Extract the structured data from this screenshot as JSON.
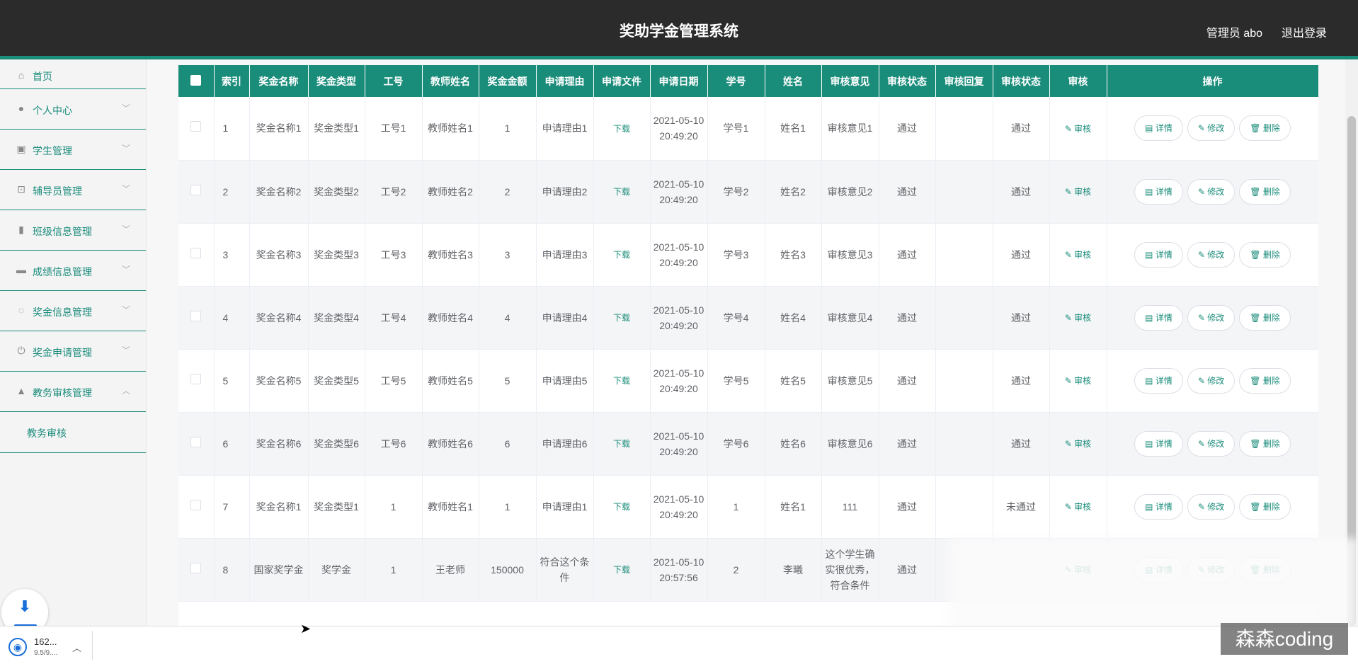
{
  "header": {
    "title": "奖助学金管理系统",
    "user": "管理员 abo",
    "logout": "退出登录"
  },
  "sidebar": {
    "items": [
      {
        "label": "首页",
        "icon": "home-icon",
        "glyph": "⌂",
        "has_children": false
      },
      {
        "label": "个人中心",
        "icon": "user-icon",
        "glyph": "●",
        "has_children": true,
        "chev": "﹀"
      },
      {
        "label": "学生管理",
        "icon": "clipboard-icon",
        "glyph": "▣",
        "has_children": true,
        "chev": "﹀"
      },
      {
        "label": "辅导员管理",
        "icon": "crop-icon",
        "glyph": "⊡",
        "has_children": true,
        "chev": "﹀"
      },
      {
        "label": "班级信息管理",
        "icon": "bar-chart-icon",
        "glyph": "▮",
        "has_children": true,
        "chev": "﹀"
      },
      {
        "label": "成绩信息管理",
        "icon": "monitor-icon",
        "glyph": "▬",
        "has_children": true,
        "chev": "﹀"
      },
      {
        "label": "奖金信息管理",
        "icon": "microphone-icon",
        "glyph": "◌",
        "has_children": true,
        "chev": "﹀"
      },
      {
        "label": "奖金申请管理",
        "icon": "power-icon",
        "glyph": "⏻",
        "has_children": true,
        "chev": "﹀"
      },
      {
        "label": "教务审核管理",
        "icon": "trend-icon",
        "glyph": "▲",
        "has_children": true,
        "chev": "︿"
      }
    ],
    "sub_item": "教务审核"
  },
  "table": {
    "headers": [
      "",
      "索引",
      "奖金名称",
      "奖金类型",
      "工号",
      "教师姓名",
      "奖金金额",
      "申请理由",
      "申请文件",
      "申请日期",
      "学号",
      "姓名",
      "审核意见",
      "审核状态",
      "审核回复",
      "审核状态",
      "审核",
      "操作"
    ],
    "download_label": "下载",
    "audit_label": "✎ 审核",
    "btn_detail": "▤ 详情",
    "btn_edit": "✎ 修改",
    "btn_delete": "🗑 删除",
    "rows": [
      {
        "index": "1",
        "name": "奖金名称1",
        "type": "奖金类型1",
        "job_no": "工号1",
        "teacher": "教师姓名1",
        "amount": "1",
        "reason": "申请理由1",
        "date": "2021-05-10 20:49:20",
        "student_no": "学号1",
        "student": "姓名1",
        "opinion": "审核意见1",
        "status1": "通过",
        "reply": "",
        "status2": "通过"
      },
      {
        "index": "2",
        "name": "奖金名称2",
        "type": "奖金类型2",
        "job_no": "工号2",
        "teacher": "教师姓名2",
        "amount": "2",
        "reason": "申请理由2",
        "date": "2021-05-10 20:49:20",
        "student_no": "学号2",
        "student": "姓名2",
        "opinion": "审核意见2",
        "status1": "通过",
        "reply": "",
        "status2": "通过"
      },
      {
        "index": "3",
        "name": "奖金名称3",
        "type": "奖金类型3",
        "job_no": "工号3",
        "teacher": "教师姓名3",
        "amount": "3",
        "reason": "申请理由3",
        "date": "2021-05-10 20:49:20",
        "student_no": "学号3",
        "student": "姓名3",
        "opinion": "审核意见3",
        "status1": "通过",
        "reply": "",
        "status2": "通过"
      },
      {
        "index": "4",
        "name": "奖金名称4",
        "type": "奖金类型4",
        "job_no": "工号4",
        "teacher": "教师姓名4",
        "amount": "4",
        "reason": "申请理由4",
        "date": "2021-05-10 20:49:20",
        "student_no": "学号4",
        "student": "姓名4",
        "opinion": "审核意见4",
        "status1": "通过",
        "reply": "",
        "status2": "通过"
      },
      {
        "index": "5",
        "name": "奖金名称5",
        "type": "奖金类型5",
        "job_no": "工号5",
        "teacher": "教师姓名5",
        "amount": "5",
        "reason": "申请理由5",
        "date": "2021-05-10 20:49:20",
        "student_no": "学号5",
        "student": "姓名5",
        "opinion": "审核意见5",
        "status1": "通过",
        "reply": "",
        "status2": "通过"
      },
      {
        "index": "6",
        "name": "奖金名称6",
        "type": "奖金类型6",
        "job_no": "工号6",
        "teacher": "教师姓名6",
        "amount": "6",
        "reason": "申请理由6",
        "date": "2021-05-10 20:49:20",
        "student_no": "学号6",
        "student": "姓名6",
        "opinion": "审核意见6",
        "status1": "通过",
        "reply": "",
        "status2": "通过"
      },
      {
        "index": "7",
        "name": "奖金名称1",
        "type": "奖金类型1",
        "job_no": "1",
        "teacher": "教师姓名1",
        "amount": "1",
        "reason": "申请理由1",
        "date": "2021-05-10 20:49:20",
        "student_no": "1",
        "student": "姓名1",
        "opinion": "111",
        "status1": "通过",
        "reply": "",
        "status2": "未通过"
      },
      {
        "index": "8",
        "name": "国家奖学金",
        "type": "奖学金",
        "job_no": "1",
        "teacher": "王老师",
        "amount": "150000",
        "reason": "符合这个条件",
        "date": "2021-05-10 20:57:56",
        "student_no": "2",
        "student": "李曦",
        "opinion": "这个学生确实很优秀，符合条件",
        "status1": "通过",
        "reply": "",
        "status2": ""
      }
    ]
  },
  "download_bar": {
    "file_name": "162...",
    "file_size": "9.5/9....",
    "caret": "︿",
    "arrow": "⬇",
    "file_glyph": "◉"
  },
  "watermark": "森森coding",
  "colors": {
    "accent": "#1a8c7a",
    "header_bg": "#2b2b2b"
  }
}
